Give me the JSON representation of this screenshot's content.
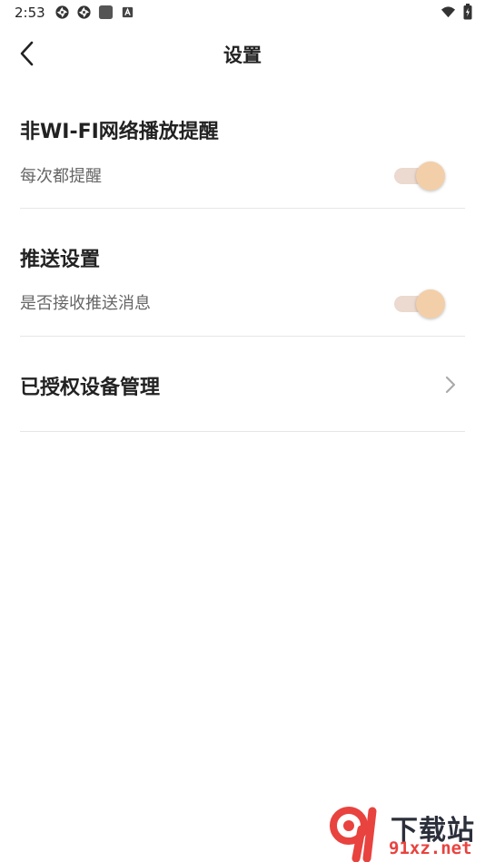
{
  "status_bar": {
    "time": "2:53",
    "icons_left": [
      "app-icon-1",
      "app-icon-2",
      "square-icon",
      "a-badge-icon"
    ],
    "icons_right": [
      "wifi-icon",
      "battery-icon"
    ]
  },
  "header": {
    "title": "设置",
    "back_icon": "chevron-left-icon"
  },
  "sections": [
    {
      "title": "非WI-FI网络播放提醒",
      "subtitle": "每次都提醒",
      "toggle_on": true
    },
    {
      "title": "推送设置",
      "subtitle": "是否接收推送消息",
      "toggle_on": true
    },
    {
      "title": "已授权设备管理",
      "chevron_icon": "chevron-right-icon"
    }
  ],
  "watermark": {
    "logo_text": "下载站",
    "url_text": "91xz.net"
  },
  "colors": {
    "toggle_track": "#ecd9cf",
    "toggle_knob": "#f3cfa9",
    "divider": "#e6e6e6",
    "watermark_red": "#e8433f"
  }
}
